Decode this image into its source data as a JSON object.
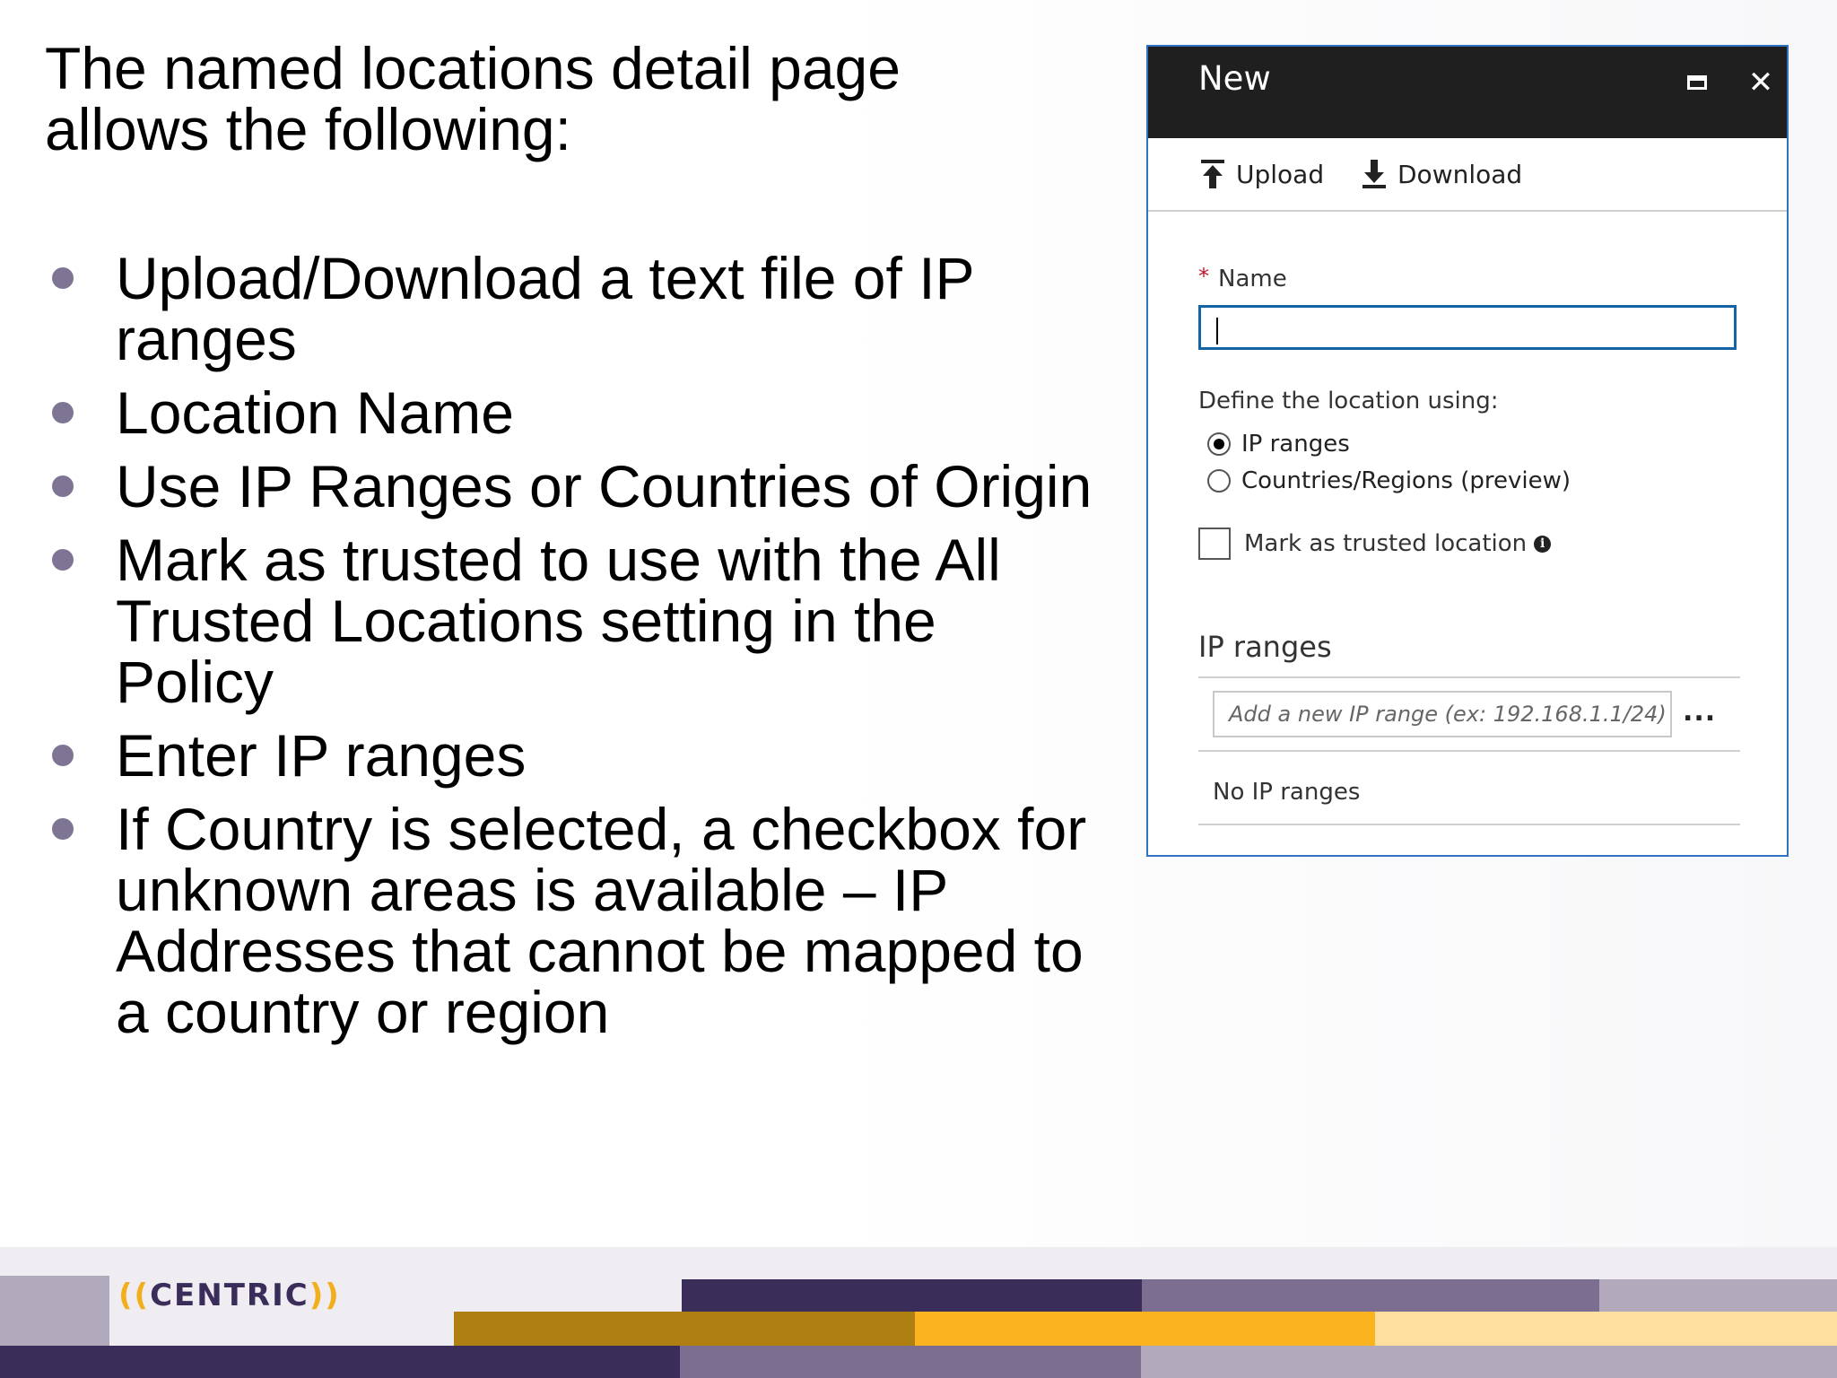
{
  "slide": {
    "title": "The named locations detail page allows the following:",
    "bullets": [
      "Upload/Download a text file of IP ranges",
      "Location Name",
      "Use IP Ranges or Countries of Origin",
      "Mark as trusted to use with the All Trusted Locations setting in the Policy",
      "Enter IP ranges",
      "If Country is selected, a checkbox for unknown areas is available – IP Addresses that cannot be mapped to a country or region"
    ]
  },
  "blade": {
    "title": "New",
    "maximize_icon": "maximize-icon",
    "close_icon": "close-icon",
    "close_glyph": "✕",
    "toolbar": {
      "upload_label": "Upload",
      "download_label": "Download"
    },
    "form": {
      "required_mark": "*",
      "name_label": "Name",
      "name_value": "",
      "define_label": "Define the location using:",
      "options": [
        {
          "label": "IP ranges",
          "selected": true
        },
        {
          "label": "Countries/Regions (preview)",
          "selected": false
        }
      ],
      "trusted_label": "Mark as trusted location",
      "trusted_checked": false,
      "info_glyph": "i"
    },
    "ip_ranges": {
      "heading": "IP ranges",
      "placeholder": "Add a new IP range (ex: 192.168.1.1/24)",
      "more_label": "...",
      "empty_text": "No IP ranges"
    }
  },
  "footer": {
    "logo_left": "((",
    "logo_text": "CENTRIC",
    "logo_right": "))"
  },
  "colors": {
    "accent": "#2e74c3",
    "bullet": "#7e7594",
    "required": "#c0142a",
    "brand_purple": "#3b2d5a",
    "brand_gold": "#f2ae1c"
  }
}
